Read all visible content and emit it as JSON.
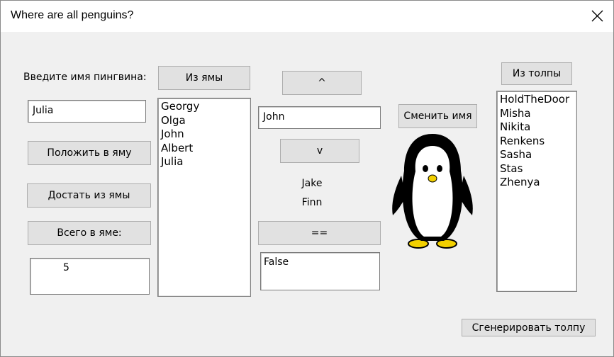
{
  "window": {
    "title": "Where are all penguins?"
  },
  "left": {
    "name_label": "Введите имя пингвина:",
    "name_input_value": "Julia",
    "put_button": "Положить в яму",
    "take_button": "Достать из ямы",
    "total_button": "Всего в яме:",
    "total_value": "5"
  },
  "pit": {
    "from_pit_button": "Из ямы",
    "items": [
      "Georgy",
      "Olga",
      "John",
      "Albert",
      "Julia"
    ]
  },
  "middle": {
    "up_button": "^",
    "current_name_value": "John",
    "down_button": "v",
    "name_a": "Jake",
    "name_b": "Finn",
    "compare_button": "==",
    "compare_result": "False"
  },
  "penguin": {
    "rename_button": "Сменить имя",
    "image": "penguin-picture"
  },
  "crowd": {
    "from_crowd_button": "Из толпы",
    "items": [
      "HoldTheDoor",
      "Misha",
      "Nikita",
      "Renkens",
      "Sasha",
      "Stas",
      "Zhenya"
    ],
    "generate_button": "Сгенерировать толпу"
  }
}
